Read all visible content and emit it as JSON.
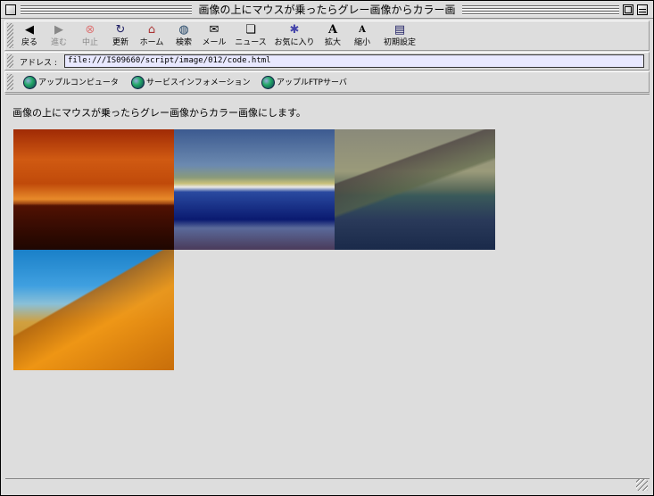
{
  "window": {
    "title": "画像の上にマウスが乗ったらグレー画像からカラー画"
  },
  "toolbar": {
    "buttons": [
      {
        "label": "戻る",
        "icon": "back-arrow-icon",
        "enabled": true
      },
      {
        "label": "進む",
        "icon": "forward-arrow-icon",
        "enabled": false
      },
      {
        "label": "中止",
        "icon": "stop-icon",
        "enabled": false
      },
      {
        "label": "更新",
        "icon": "refresh-icon",
        "enabled": true
      },
      {
        "label": "ホーム",
        "icon": "home-icon",
        "enabled": true
      },
      {
        "label": "検索",
        "icon": "search-globe-icon",
        "enabled": true
      },
      {
        "label": "メール",
        "icon": "mail-icon",
        "enabled": true
      },
      {
        "label": "ニュース",
        "icon": "news-icon",
        "enabled": true
      },
      {
        "label": "お気に入り",
        "icon": "favorites-icon",
        "enabled": true
      },
      {
        "label": "拡大",
        "icon": "text-larger-icon",
        "enabled": true
      },
      {
        "label": "縮小",
        "icon": "text-smaller-icon",
        "enabled": true
      },
      {
        "label": "初期設定",
        "icon": "preferences-icon",
        "enabled": true
      }
    ]
  },
  "address": {
    "label": "アドレス :",
    "value": "file:///IS09660/script/image/012/code.html"
  },
  "favorites": [
    {
      "label": "アップルコンピュータ"
    },
    {
      "label": "サービスインフォメーション"
    },
    {
      "label": "アップルFTPサーバ"
    }
  ],
  "content": {
    "intro": "画像の上にマウスが乗ったらグレー画像からカラー画像にします。"
  }
}
